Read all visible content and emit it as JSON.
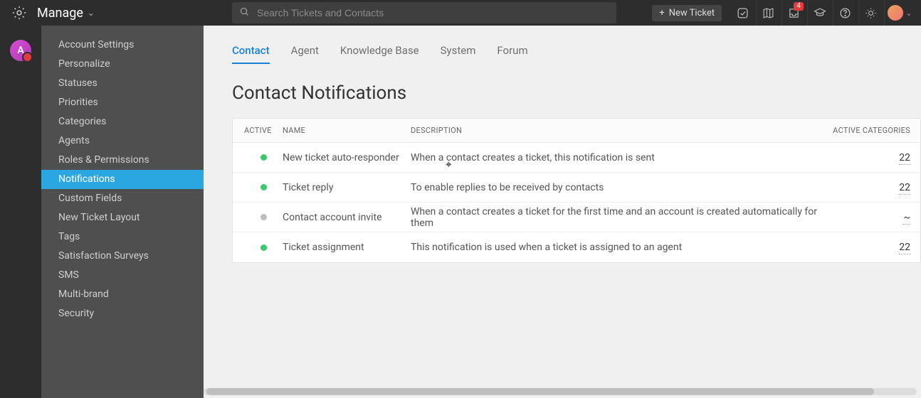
{
  "topbar": {
    "title": "Manage",
    "search_placeholder": "Search Tickets and Contacts",
    "new_ticket_label": "New Ticket",
    "notification_count": "4"
  },
  "rail": {
    "avatar_initial": "A"
  },
  "sidebar": {
    "items": [
      {
        "label": "Account Settings",
        "active": false
      },
      {
        "label": "Personalize",
        "active": false
      },
      {
        "label": "Statuses",
        "active": false
      },
      {
        "label": "Priorities",
        "active": false
      },
      {
        "label": "Categories",
        "active": false
      },
      {
        "label": "Agents",
        "active": false
      },
      {
        "label": "Roles & Permissions",
        "active": false
      },
      {
        "label": "Notifications",
        "active": true
      },
      {
        "label": "Custom Fields",
        "active": false
      },
      {
        "label": "New Ticket Layout",
        "active": false
      },
      {
        "label": "Tags",
        "active": false
      },
      {
        "label": "Satisfaction Surveys",
        "active": false
      },
      {
        "label": "SMS",
        "active": false
      },
      {
        "label": "Multi-brand",
        "active": false
      },
      {
        "label": "Security",
        "active": false
      }
    ]
  },
  "tabs": [
    {
      "label": "Contact",
      "active": true
    },
    {
      "label": "Agent",
      "active": false
    },
    {
      "label": "Knowledge Base",
      "active": false
    },
    {
      "label": "System",
      "active": false
    },
    {
      "label": "Forum",
      "active": false
    }
  ],
  "page_title": "Contact Notifications",
  "table": {
    "columns": {
      "active": "ACTIVE",
      "name": "NAME",
      "desc": "DESCRIPTION",
      "cats": "ACTIVE CATEGORIES"
    },
    "rows": [
      {
        "active": true,
        "name": "New ticket auto-responder",
        "desc": "When a contact creates a ticket, this notification is sent",
        "cats": "22"
      },
      {
        "active": true,
        "name": "Ticket reply",
        "desc": "To enable replies to be received by contacts",
        "cats": "22"
      },
      {
        "active": false,
        "name": "Contact account invite",
        "desc": "When a contact creates a ticket for the first time and an account is created automatically for them",
        "cats": "~"
      },
      {
        "active": true,
        "name": "Ticket assignment",
        "desc": "This notification is used when a ticket is assigned to an agent",
        "cats": "22"
      }
    ]
  }
}
